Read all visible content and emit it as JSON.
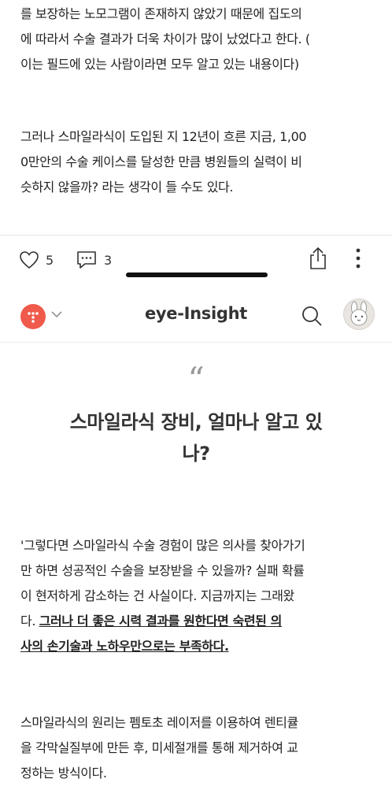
{
  "article_top": {
    "lines_p1": [
      "를 보장하는 노모그램이 존재하지 않았기 때문에 집도의",
      "에 따라서 수술 결과가 더욱 차이가 많이 났었다고 한다. (",
      "이는 필드에 있는 사람이라면 모두 알고 있는 내용이다)"
    ],
    "lines_p2": [
      "그러나 스마일라식이 도입된 지 12년이 흐른 지금, 1,00",
      "0만안의 수술 케이스를 달성한 만큼 병원들의 실력이 비",
      "슷하지 않을까? 라는 생각이 들 수도 있다."
    ]
  },
  "actions": {
    "like_count": "5",
    "comment_count": "3"
  },
  "header": {
    "title": "eye-Insight"
  },
  "quote": {
    "mark": "“",
    "headline_lines": [
      "스마일라식 장비, 얼마나 알고 있",
      "나?"
    ]
  },
  "body": {
    "p1_lines": [
      "'그렇다면 스마일라식 수술 경험이 많은 의사를 찾아가기",
      "만 하면 성공적인 수술을 보장받을 수 있을까? 실패 확률",
      "이 현저하게 감소하는 건 사실이다. 지금까지는 그래왔"
    ],
    "p1_line4_plain": "다. ",
    "p1_line4_bold": "그러나 더 좋은 시력 결과를 원한다면 숙련된 의",
    "p1_line5_bold": "사의 손기술과 노하우만으로는 부족하다.",
    "p2_lines": [
      "스마일라식의 원리는 펨토초 레이저를 이용하여 렌티큘",
      "을 각막실질부에 만든 후, 미세절개를 통해 제거하여 교",
      "정하는 방식이다."
    ]
  },
  "colors": {
    "logo": "#ef5a4b",
    "text": "#222222",
    "muted": "#999999"
  }
}
